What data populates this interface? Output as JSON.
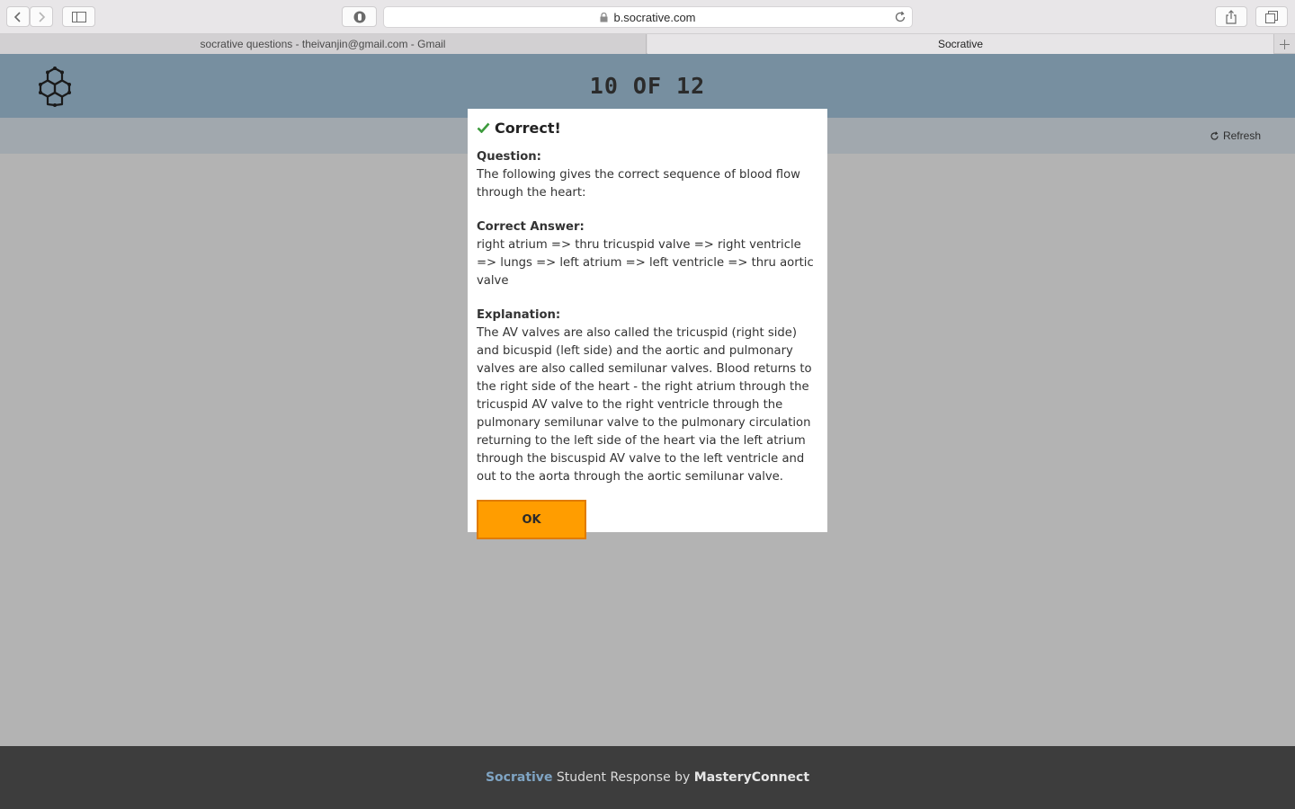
{
  "browser": {
    "url": "b.socrative.com",
    "tabs": [
      {
        "title": "socrative questions - theivanjin@gmail.com - Gmail",
        "active": false
      },
      {
        "title": "Socrative",
        "active": true
      }
    ]
  },
  "header": {
    "progress": "10 OF 12",
    "refresh_label": "Refresh"
  },
  "modal": {
    "title": "Correct!",
    "question_label": "Question:",
    "question_text": "The following gives the correct sequence of blood flow through the heart:",
    "answer_label": "Correct Answer:",
    "answer_text": "right atrium => thru tricuspid valve => right ventricle => lungs => left atrium => left ventricle => thru aortic valve",
    "explanation_label": "Explanation:",
    "explanation_text": "The AV valves are also called the tricuspid (right side) and bicuspid (left side) and the aortic and pulmonary valves are also called semilunar valves.  Blood returns to the right side of the heart - the right atrium through the tricuspid AV valve to the right ventricle through the pulmonary semilunar valve to the pulmonary circulation returning to the left side of the heart via the left atrium through the biscuspid AV valve to the left ventricle and out to the aorta through the aortic semilunar valve.",
    "ok_label": "OK"
  },
  "footer": {
    "brand": "Socrative",
    "middle": " Student Response by ",
    "company": "MasteryConnect"
  },
  "colors": {
    "header_bg": "#778fa0",
    "button_orange": "#ff9d00",
    "check_green": "#3c9a3c",
    "footer_bg": "#3d3d3d"
  }
}
